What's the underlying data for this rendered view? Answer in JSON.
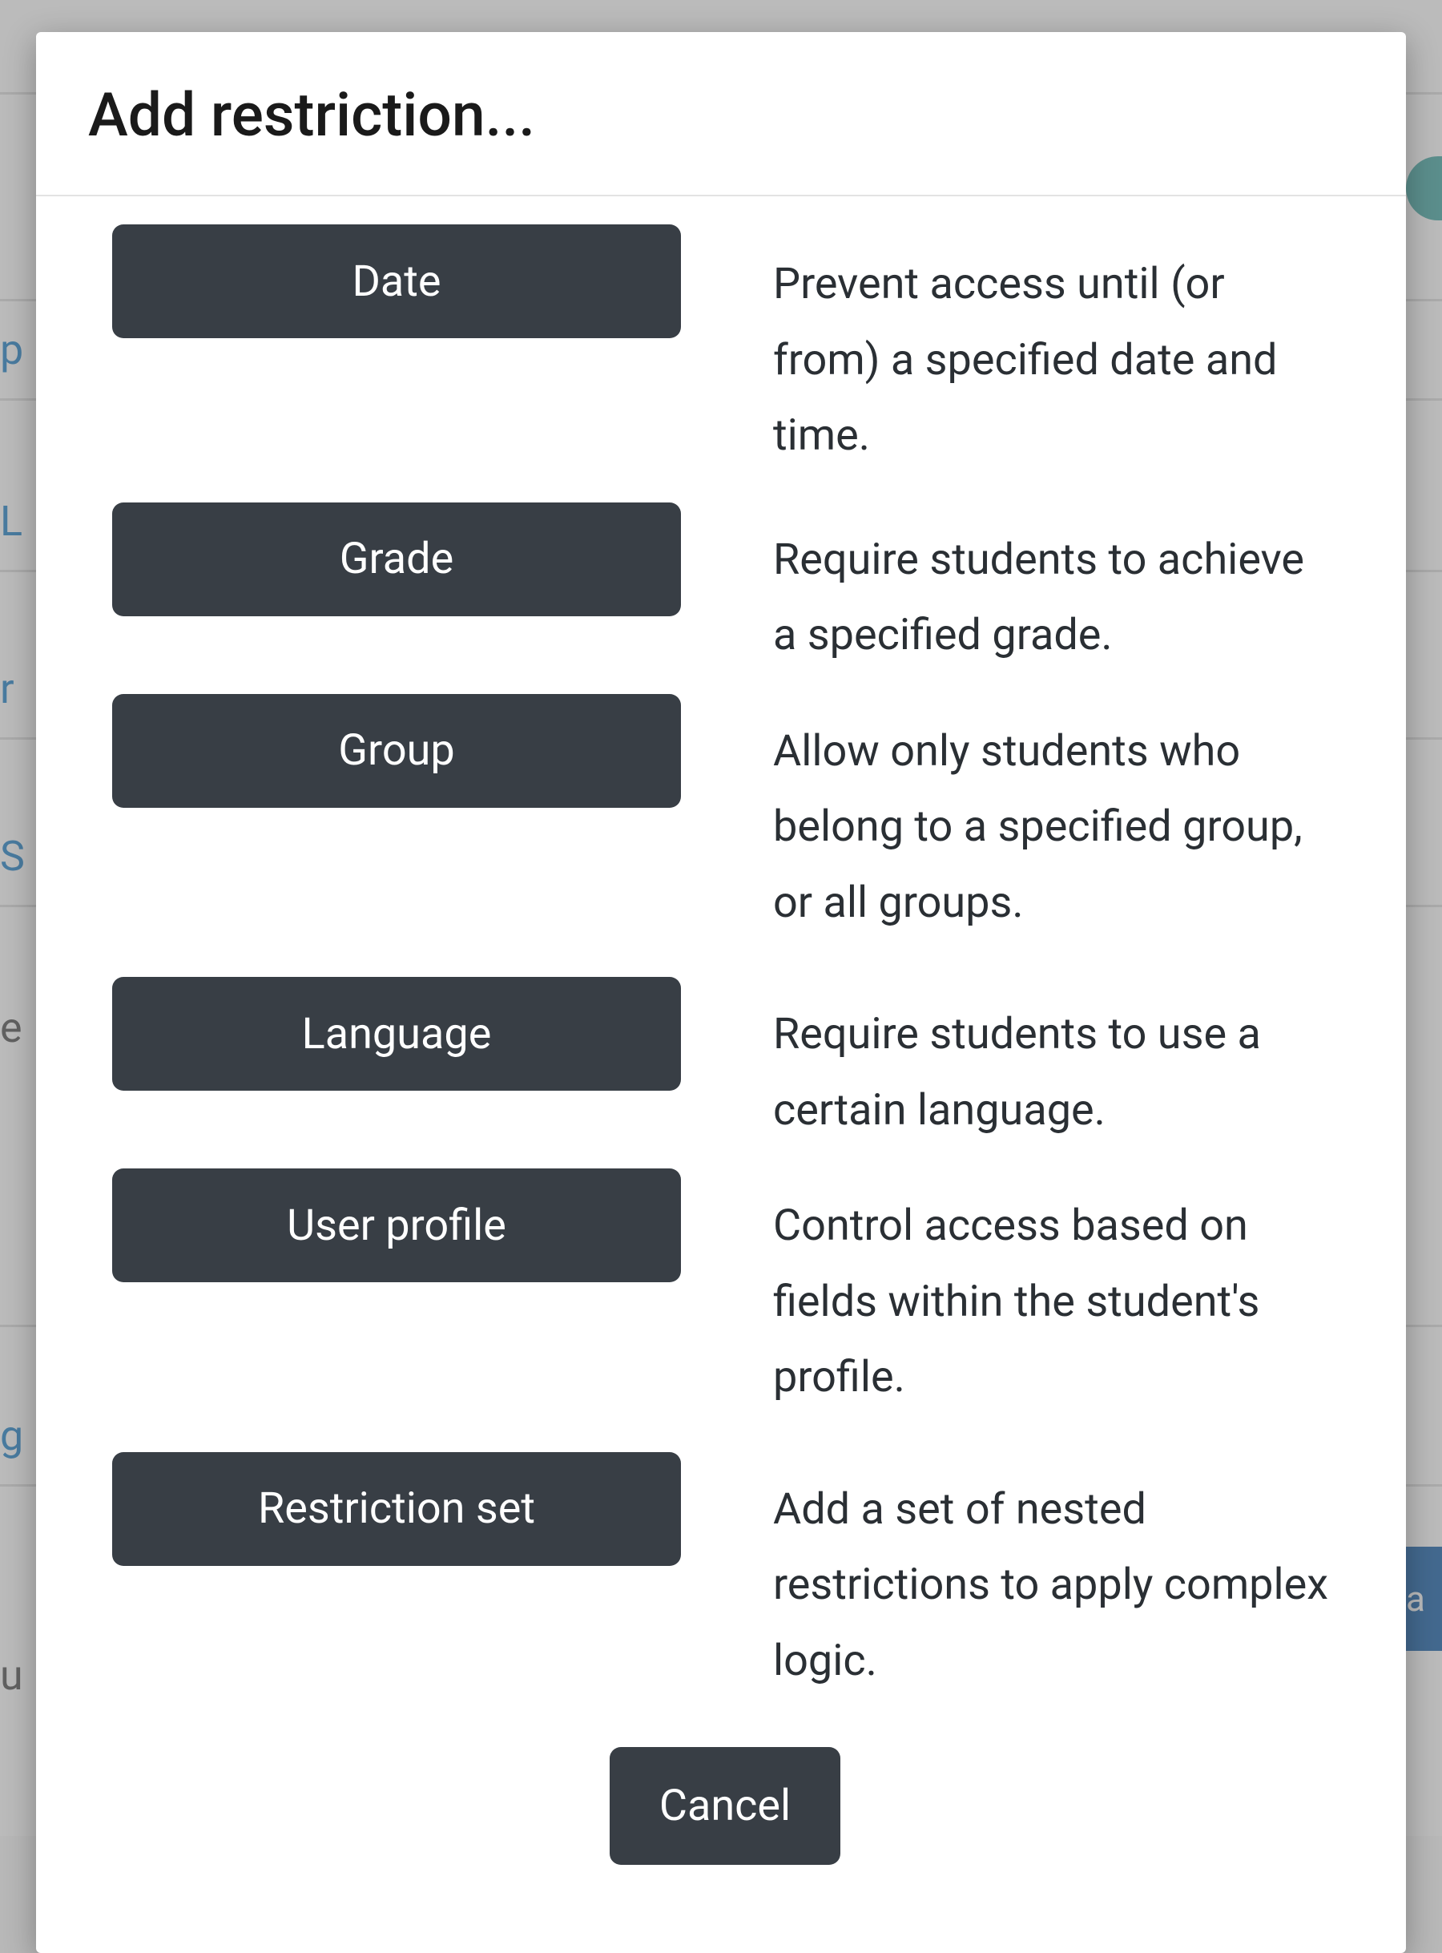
{
  "modal": {
    "title": "Add restriction...",
    "restrictions": [
      {
        "label": "Date",
        "description": "Prevent access until (or from) a specified date and time."
      },
      {
        "label": "Grade",
        "description": "Require students to achieve a specified grade."
      },
      {
        "label": "Group",
        "description": "Allow only students who belong to a specified group, or all groups."
      },
      {
        "label": "Language",
        "description": "Require students to use a certain language."
      },
      {
        "label": "User profile",
        "description": "Control access based on fields within the student's profile."
      },
      {
        "label": "Restriction set",
        "description": "Add a set of nested restrictions to apply complex logic."
      }
    ],
    "cancel_label": "Cancel"
  },
  "background": {
    "links": [
      "p",
      "L",
      "r",
      "S"
    ],
    "text1": "e",
    "link2": "g",
    "text2": "u",
    "blue_btn": "a"
  }
}
